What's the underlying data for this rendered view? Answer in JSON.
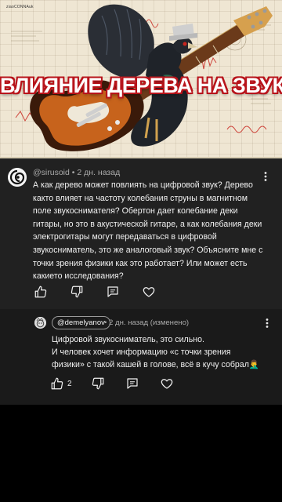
{
  "video": {
    "headline": "ВЛИЯНИЕ ДЕРЕВА НА ЗВУК",
    "brand_tag": "ziaoCONNAuk"
  },
  "comment": {
    "author": "@sirusoid",
    "time": "2 дн. назад",
    "separator": "•",
    "text": "А как дерево может повлиять на цифровой звук? Дерево както влияет на частоту колебания струны в магнитном поле звукоснимателя? Обертон дает колебание деки гитары, но это в акустической гитаре, а как колебания деки электрогитары могут передаваться в цифровой звукосниматель, это же аналоговый звук? Объясните мне с точки зрения физики как это работает? Или может есть какието исследования?",
    "like_count": ""
  },
  "reply": {
    "author": "@demelyanov",
    "time": "2 дн. назад (изменено)",
    "separator": "•",
    "line1": "Цифровой звукосниматель, это сильно.",
    "line2": "И человек хочет информацию «с точки зрения",
    "line3": "физики» с такой кашей в голове, всё в кучу собрал🤦‍♂️",
    "like_count": "2"
  },
  "colors": {
    "background": "#000000",
    "comment_bg": "#212121",
    "reply_bg": "#1a1a1a",
    "text": "#f1f1f1",
    "meta": "#aaaaaa",
    "headline_stroke": "#b8141b"
  },
  "icons": [
    "like-icon",
    "dislike-icon",
    "reply-icon",
    "heart-icon",
    "more-vert-icon"
  ]
}
